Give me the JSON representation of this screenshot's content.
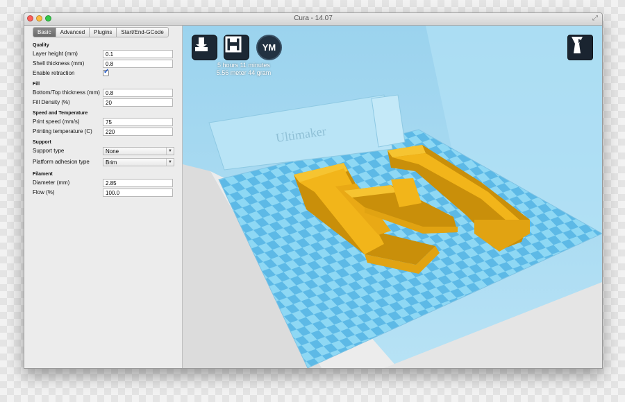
{
  "window": {
    "title": "Cura - 14.07"
  },
  "tabs": [
    "Basic",
    "Advanced",
    "Plugins",
    "Start/End-GCode"
  ],
  "settings": {
    "quality": {
      "title": "Quality",
      "layer_height": {
        "label": "Layer height (mm)",
        "value": "0.1"
      },
      "shell_thickness": {
        "label": "Shell thickness (mm)",
        "value": "0.8"
      },
      "enable_retraction": {
        "label": "Enable retraction",
        "checked": true
      }
    },
    "fill": {
      "title": "Fill",
      "bottom_top_thickness": {
        "label": "Bottom/Top thickness (mm)",
        "value": "0.8"
      },
      "fill_density": {
        "label": "Fill Density (%)",
        "value": "20"
      }
    },
    "speed_temp": {
      "title": "Speed and Temperature",
      "print_speed": {
        "label": "Print speed (mm/s)",
        "value": "75"
      },
      "printing_temperature": {
        "label": "Printing temperature (C)",
        "value": "220"
      }
    },
    "support": {
      "title": "Support",
      "support_type": {
        "label": "Support type",
        "value": "None"
      },
      "platform_adhesion": {
        "label": "Platform adhesion type",
        "value": "Brim"
      }
    },
    "filament": {
      "title": "Filament",
      "diameter": {
        "label": "Diameter (mm)",
        "value": "2.85"
      },
      "flow": {
        "label": "Flow (%)",
        "value": "100.0"
      }
    }
  },
  "viewport": {
    "buttons": [
      "load-model",
      "save-toolpath",
      "youmagine"
    ],
    "youmagine_label": "YM",
    "print_time": "5 hours 11 minutes",
    "material": "5.56 meter 44 gram",
    "plate_text": "Ultimaker",
    "colors": {
      "model": "#f2b51a",
      "bed_light": "#8ed8f4",
      "bed_dark": "#5db9e6",
      "backdrop": "#a3d9f2"
    }
  }
}
